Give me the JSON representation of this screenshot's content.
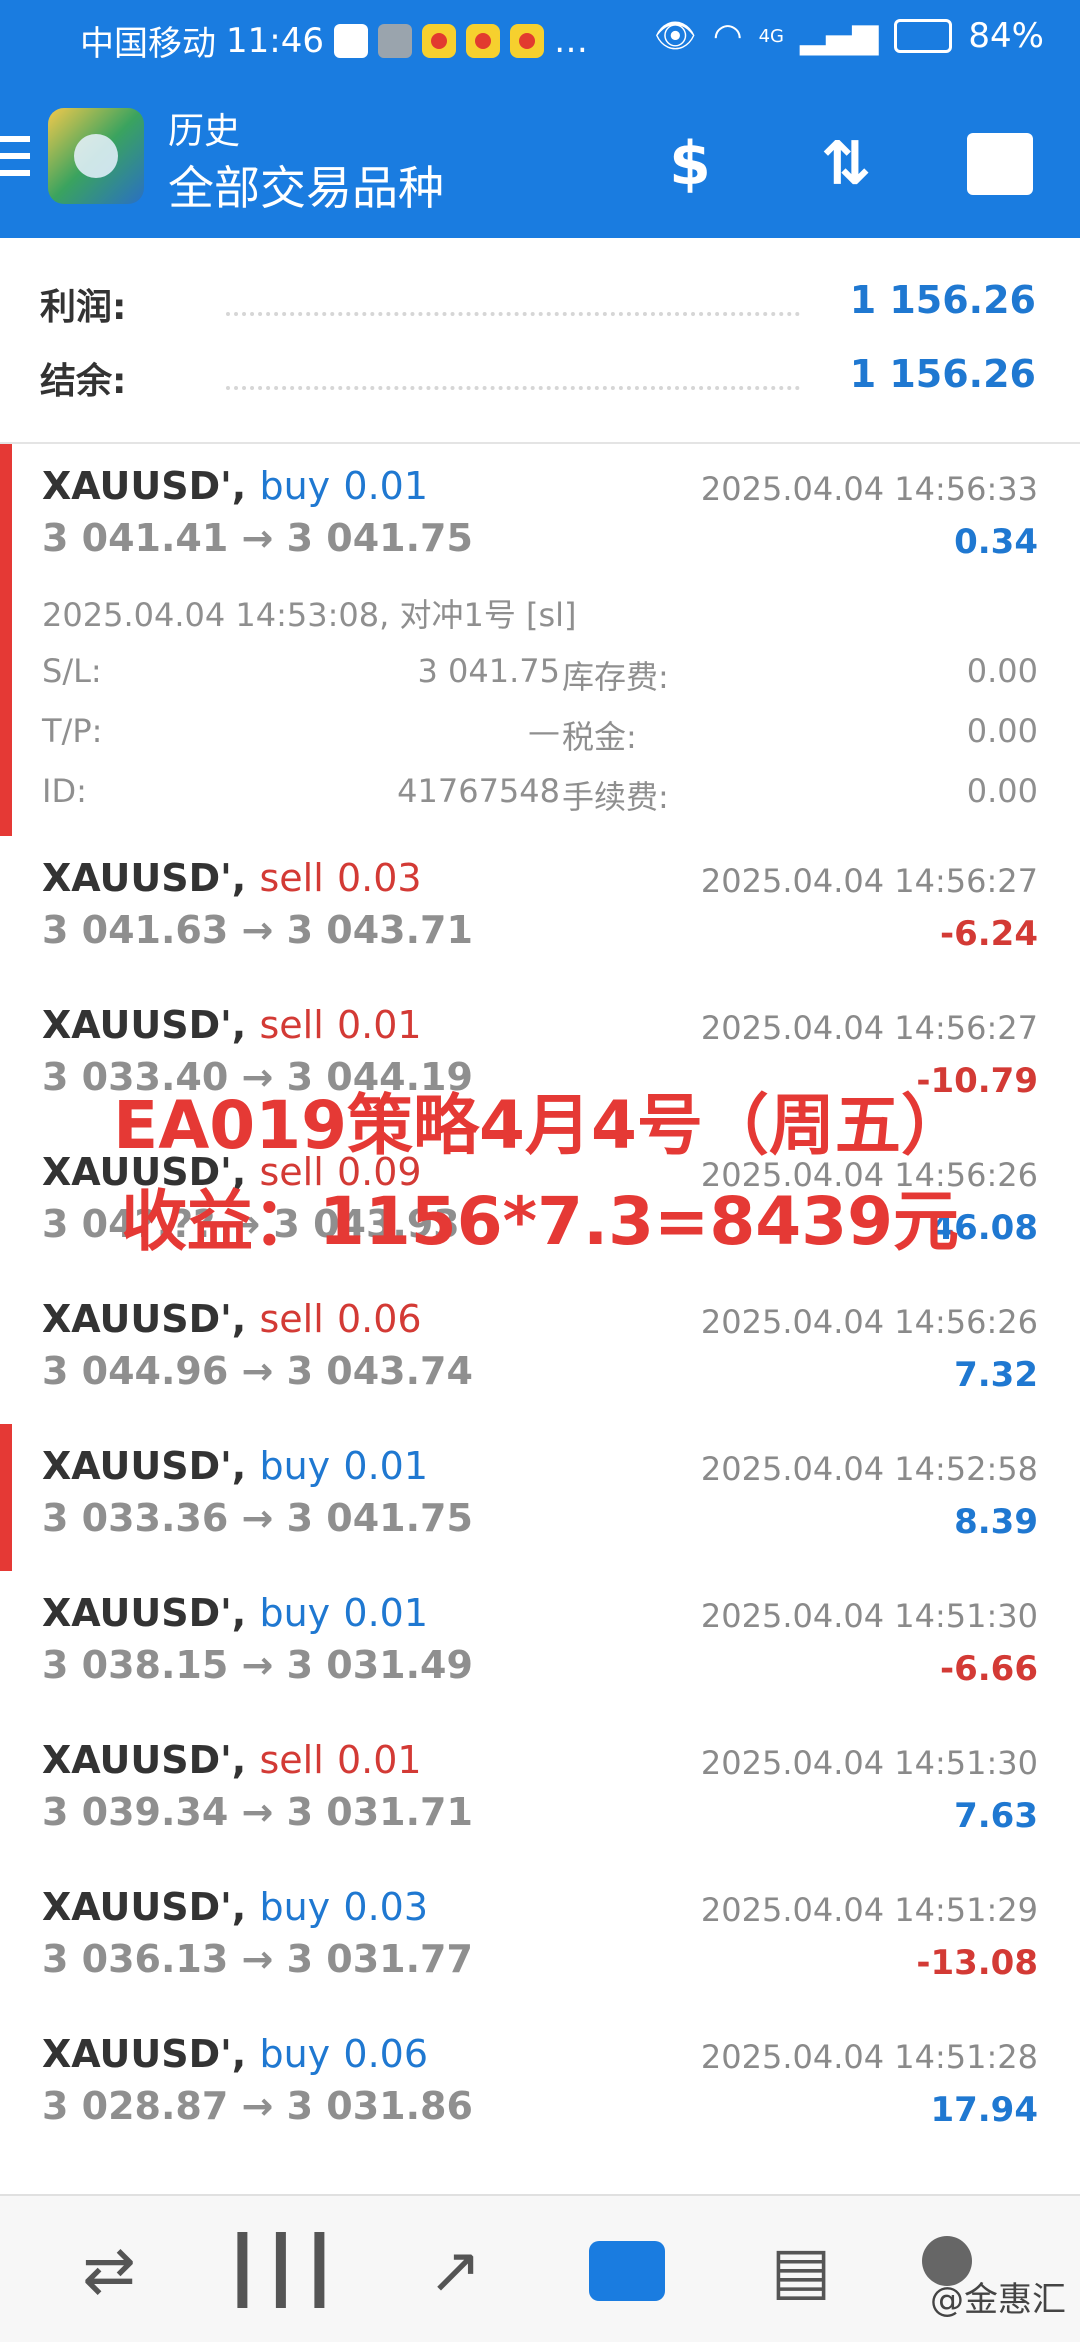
{
  "status_bar": {
    "carrier": "中国移动",
    "time": "11:46",
    "more": "…",
    "network": "4G",
    "battery": "84%"
  },
  "app_bar": {
    "section": "历史",
    "subtitle": "全部交易品种",
    "icons": [
      "menu-icon",
      "app-logo",
      "currency-exchange-icon",
      "sort-icon",
      "calendar-icon"
    ]
  },
  "summary": {
    "profit_label": "利润:",
    "profit_value": "1 156.26",
    "balance_label": "结余:",
    "balance_value": "1 156.26"
  },
  "trades": [
    {
      "symbol": "XAUUSD',",
      "side": "buy",
      "volume": "0.01",
      "time": "2025.04.04 14:56:33",
      "prices": "3 041.41 → 3 041.75",
      "profit": "0.34",
      "expanded": true,
      "detail": {
        "open_line": "2025.04.04 14:53:08, 对冲1号 [sl]",
        "sl_label": "S/L:",
        "sl_value": "3 041.75",
        "swap_label": "库存费:",
        "swap_value": "0.00",
        "tp_label": "T/P:",
        "tp_value": "—",
        "tax_label": "税金:",
        "tax_value": "0.00",
        "id_label": "ID:",
        "id_value": "41767548",
        "fee_label": "手续费:",
        "fee_value": "0.00"
      }
    },
    {
      "symbol": "XAUUSD',",
      "side": "sell",
      "volume": "0.03",
      "time": "2025.04.04 14:56:27",
      "prices": "3 041.63 → 3 043.71",
      "profit": "-6.24"
    },
    {
      "symbol": "XAUUSD',",
      "side": "sell",
      "volume": "0.01",
      "time": "2025.04.04 14:56:27",
      "prices": "3 033.40 → 3 044.19",
      "profit": "-10.79"
    },
    {
      "symbol": "XAUUSD',",
      "side": "sell",
      "volume": "0.09",
      "time": "2025.04.04 14:56:26",
      "prices": "3 04?.?? → 3 043.93",
      "profit": "46.08"
    },
    {
      "symbol": "XAUUSD',",
      "side": "sell",
      "volume": "0.06",
      "time": "2025.04.04 14:56:26",
      "prices": "3 044.96 → 3 043.74",
      "profit": "7.32"
    },
    {
      "symbol": "XAUUSD',",
      "side": "buy",
      "volume": "0.01",
      "time": "2025.04.04 14:52:58",
      "prices": "3 033.36 → 3 041.75",
      "profit": "8.39"
    },
    {
      "symbol": "XAUUSD',",
      "side": "buy",
      "volume": "0.01",
      "time": "2025.04.04 14:51:30",
      "prices": "3 038.15 → 3 031.49",
      "profit": "-6.66"
    },
    {
      "symbol": "XAUUSD',",
      "side": "sell",
      "volume": "0.01",
      "time": "2025.04.04 14:51:30",
      "prices": "3 039.34 → 3 031.71",
      "profit": "7.63"
    },
    {
      "symbol": "XAUUSD',",
      "side": "buy",
      "volume": "0.03",
      "time": "2025.04.04 14:51:29",
      "prices": "3 036.13 → 3 031.77",
      "profit": "-13.08"
    },
    {
      "symbol": "XAUUSD',",
      "side": "buy",
      "volume": "0.06",
      "time": "2025.04.04 14:51:28",
      "prices": "3 028.87 → 3 031.86",
      "profit": "17.94"
    }
  ],
  "overlay": {
    "line1": "EA019策略4月4号（周五）",
    "line2": "收益：1156*7.3=8439元",
    "color": "#e53935"
  },
  "bottom_nav": {
    "items": [
      "quotes-icon",
      "chart-candles-icon",
      "trade-icon",
      "history-icon",
      "news-icon",
      "messages-icon"
    ],
    "active": "history-icon"
  },
  "watermark": "@金惠汇",
  "colors": {
    "primary": "#1a7ce0",
    "buy_blue": "#1f78d1",
    "sell_red": "#d33a35",
    "flag_red": "#e53935"
  }
}
